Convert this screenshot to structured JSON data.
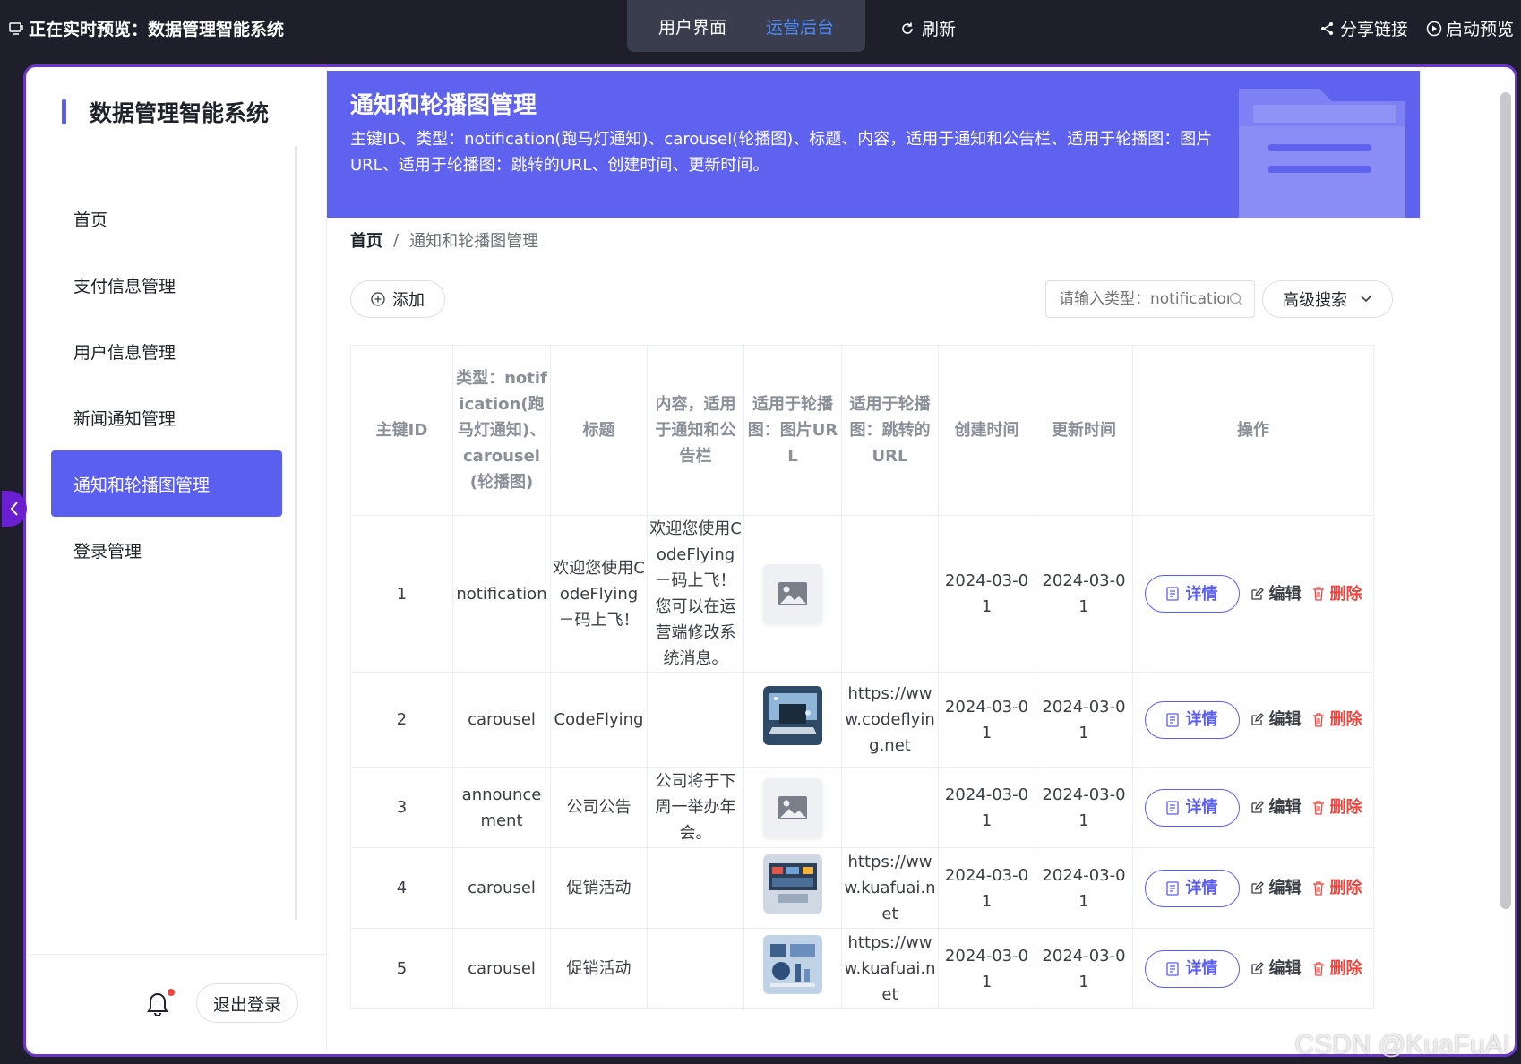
{
  "preview_bar": {
    "title": "正在实时预览：数据管理智能系统",
    "switch": {
      "user_ui": "用户界面",
      "admin": "运营后台"
    },
    "refresh": "刷新",
    "share": "分享链接",
    "start": "启动预览"
  },
  "sidebar": {
    "title": "数据管理智能系统",
    "items": [
      {
        "label": "首页",
        "active": false
      },
      {
        "label": "支付信息管理",
        "active": false
      },
      {
        "label": "用户信息管理",
        "active": false
      },
      {
        "label": "新闻通知管理",
        "active": false
      },
      {
        "label": "通知和轮播图管理",
        "active": true
      },
      {
        "label": "登录管理",
        "active": false
      }
    ],
    "logout": "退出登录"
  },
  "banner": {
    "title": "通知和轮播图管理",
    "description": "主键ID、类型：notification(跑马灯通知)、carousel(轮播图)、标题、内容，适用于通知和公告栏、适用于轮播图：图片URL、适用于轮播图：跳转的URL、创建时间、更新时间。"
  },
  "breadcrumb": {
    "home": "首页",
    "separator": "/",
    "current": "通知和轮播图管理"
  },
  "toolbar": {
    "add": "添加",
    "search_placeholder": "请输入类型：notification",
    "advanced": "高级搜索"
  },
  "table": {
    "headers": {
      "id": "主键ID",
      "type": "类型：notification(跑马灯通知)、carousel(轮播图)",
      "title": "标题",
      "content": "内容，适用于通知和公告栏",
      "image": "适用于轮播图：图片URL",
      "link": "适用于轮播图：跳转的URL",
      "created": "创建时间",
      "updated": "更新时间",
      "ops": "操作"
    },
    "rows": [
      {
        "id": "1",
        "type": "notification",
        "title": "欢迎您使用CodeFlying－码上飞！",
        "content": "欢迎您使用CodeFlying－码上飞！您可以在运营端修改系统消息。",
        "image": "placeholder",
        "link": "",
        "created": "2024-03-01",
        "updated": "2024-03-01"
      },
      {
        "id": "2",
        "type": "carousel",
        "title": "CodeFlying",
        "content": "",
        "image": "laptop-photo",
        "link": "https://www.codeflying.net",
        "created": "2024-03-01",
        "updated": "2024-03-01"
      },
      {
        "id": "3",
        "type": "announcement",
        "title": "公司公告",
        "content": "公司将于下周一举办年会。",
        "image": "placeholder",
        "link": "",
        "created": "2024-03-01",
        "updated": "2024-03-01"
      },
      {
        "id": "4",
        "type": "carousel",
        "title": "促销活动",
        "content": "",
        "image": "dashboard-photo",
        "link": "https://www.kuafuai.net",
        "created": "2024-03-01",
        "updated": "2024-03-01"
      },
      {
        "id": "5",
        "type": "carousel",
        "title": "促销活动",
        "content": "",
        "image": "analytics-photo",
        "link": "https://www.kuafuai.net",
        "created": "2024-03-01",
        "updated": "2024-03-01"
      }
    ],
    "actions": {
      "detail": "详情",
      "edit": "编辑",
      "delete": "删除"
    }
  },
  "watermark": "CSDN @KuaFuAI",
  "colors": {
    "accent": "#5b5ff0",
    "danger": "#f0453e",
    "frame": "#6a35c9",
    "topbar": "#1e1f2b"
  }
}
